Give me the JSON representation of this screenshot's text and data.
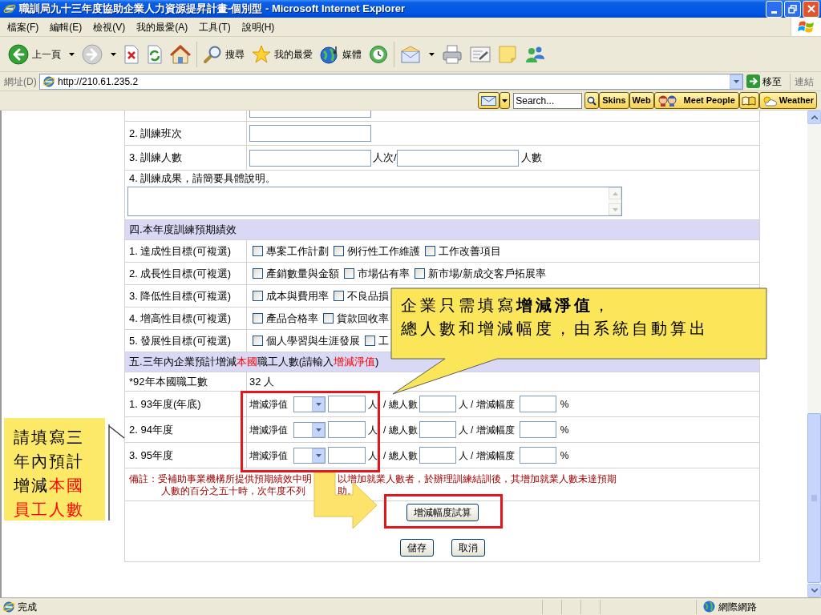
{
  "window": {
    "title": "職訓局九十三年度協助企業人力資源提昇計畫-個別型 - Microsoft Internet Explorer"
  },
  "menu": [
    {
      "label": "檔案(F)"
    },
    {
      "label": "編輯(E)"
    },
    {
      "label": "檢視(V)"
    },
    {
      "label": "我的最愛(A)"
    },
    {
      "label": "工具(T)"
    },
    {
      "label": "說明(H)"
    }
  ],
  "toolbar": [
    {
      "kind": "back",
      "label": "上一頁",
      "dropdown": true
    },
    {
      "kind": "forward",
      "dropdown": true
    },
    {
      "kind": "stop",
      "dropdown": false
    },
    {
      "kind": "refresh",
      "dropdown": false
    },
    {
      "kind": "home",
      "dropdown": false
    },
    {
      "kind": "search",
      "label": "搜尋",
      "dropdown": false
    },
    {
      "kind": "favorites",
      "label": "我的最愛",
      "dropdown": false
    },
    {
      "kind": "media",
      "label": "媒體",
      "dropdown": false
    },
    {
      "kind": "history",
      "dropdown": false
    },
    {
      "kind": "mail",
      "dropdown": true
    },
    {
      "kind": "print",
      "dropdown": false
    },
    {
      "kind": "edit",
      "dropdown": false
    },
    {
      "kind": "note",
      "dropdown": false
    },
    {
      "kind": "messenger",
      "dropdown": false
    }
  ],
  "address_bar": {
    "label": "網址(D)",
    "value": "http://210.61.235.2",
    "go": "移至",
    "links": "連結"
  },
  "search_toolbar": [
    {
      "kind": "mail"
    },
    {
      "kind": "dropdown"
    },
    {
      "kind": "field",
      "placeholder": "Search..."
    },
    {
      "kind": "search"
    },
    {
      "kind": "text",
      "label": "Skins"
    },
    {
      "kind": "text",
      "label": "Web"
    },
    {
      "kind": "people",
      "label": "Meet People"
    },
    {
      "kind": "book"
    },
    {
      "kind": "weather",
      "label": "Weather"
    }
  ],
  "form": {
    "upper_rows": [
      {
        "kind": "cut"
      },
      {
        "kind": "single",
        "label": "2. 訓練班次"
      },
      {
        "kind": "double",
        "label": "3. 訓練人數",
        "unit_1": "人次/",
        "unit_2": "人數"
      },
      {
        "kind": "textarea",
        "label": "4. 訓練成果，請簡要具體說明。"
      }
    ],
    "goals_title": "四.本年度訓練預期績效",
    "goals": [
      {
        "label": "1. 達成性目標(可複選)",
        "options": [
          {
            "label": "專案工作計劃",
            "checked": false
          },
          {
            "label": "例行性工作維護",
            "checked": false
          },
          {
            "label": "工作改善項目",
            "checked": false
          }
        ]
      },
      {
        "label": "2. 成長性目標(可複選)",
        "options": [
          {
            "label": "產銷數量與金額",
            "checked": false
          },
          {
            "label": "市場佔有率",
            "checked": false
          },
          {
            "label": "新市場/新成交客戶拓展率",
            "checked": false
          }
        ]
      },
      {
        "label": "3. 降低性目標(可複選)",
        "options": [
          {
            "label": "成本與費用率",
            "checked": false
          },
          {
            "label": "不良品損",
            "checked": false
          }
        ]
      },
      {
        "label": "4. 增高性目標(可複選)",
        "options": [
          {
            "label": "產品合格率",
            "checked": false
          },
          {
            "label": "貨款回收率",
            "checked": false
          }
        ]
      },
      {
        "label": "5. 發展性目標(可複選)",
        "options": [
          {
            "label": "個人學習與生涯發展",
            "checked": false
          },
          {
            "label": "工",
            "checked": false
          }
        ]
      }
    ],
    "staff_title": [
      {
        "text": "五.三年內企業預計增減",
        "highlight": false
      },
      {
        "text": "本國",
        "highlight": true
      },
      {
        "text": "職工人數(請輸入",
        "highlight": false
      },
      {
        "text": "增減淨值",
        "highlight": true
      },
      {
        "text": ")",
        "highlight": false
      }
    ],
    "staff_baseline": {
      "label": "*92年本國職工數",
      "value": "32 人"
    },
    "staff_years": [
      {
        "label": "1. 93年度(年底)",
        "net_label": "增減淨值",
        "unit_1": "人",
        "unit_2": "/ 總人數",
        "unit_3": "人 / 增減幅度",
        "unit_4": "%"
      },
      {
        "label": "2. 94年度",
        "net_label": "增減淨值",
        "unit_1": "人",
        "unit_2": "/ 總人數",
        "unit_3": "人 / 增減幅度",
        "unit_4": "%"
      },
      {
        "label": "3. 95年度",
        "net_label": "增減淨值",
        "unit_1": "人",
        "unit_2": "/ 總人數",
        "unit_3": "人 / 增減幅度",
        "unit_4": "%"
      }
    ],
    "note": {
      "line_1": [
        "備註：受補助事業機構所提供預期績效中明",
        "以增加就業人數者，於辦理訓練結訓後，其增加就業人數未達預期"
      ],
      "line_2": [
        "人數的百分之五十時，次年度不列",
        "助。"
      ]
    },
    "calc_button": "增減幅度試算",
    "buttons": [
      {
        "label": "儲存"
      },
      {
        "label": "取消"
      }
    ]
  },
  "annotations": {
    "callout": {
      "lines": [
        "企業只需填寫**增減淨值**，",
        "總人數和增減幅度，由系統自動算出"
      ]
    },
    "side_note": {
      "segments": [
        {
          "text": "請填寫三年內預計增減",
          "highlight": false
        },
        {
          "text": "本國員工人數",
          "highlight": true
        }
      ]
    }
  },
  "status_bar": {
    "text": "完成",
    "zone": "網際網路"
  }
}
